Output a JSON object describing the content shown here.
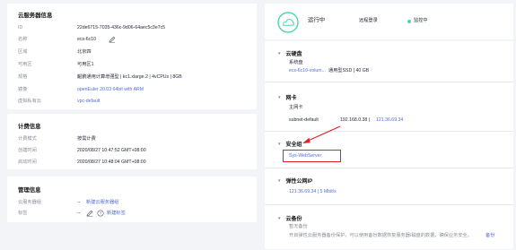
{
  "server_info": {
    "title": "云服务器信息",
    "rows": [
      {
        "label": "ID",
        "value": "22de6715-7035-436c-9d06-64aec5c3e7c5"
      },
      {
        "label": "名称",
        "value": "ecs-6c10"
      },
      {
        "label": "区域",
        "value": "北京四"
      },
      {
        "label": "可用区",
        "value": "可用区1"
      },
      {
        "label": "规格",
        "value": "鲲鹏通用计算增强型 | kc1.xlarge.2 | 4vCPUs | 8GB"
      },
      {
        "label": "镜像",
        "value": "openEuler 20.03 64bit with ARM"
      },
      {
        "label": "虚拟私有云",
        "value": "vpc-default"
      }
    ]
  },
  "billing_info": {
    "title": "计费信息",
    "rows": [
      {
        "label": "计费模式",
        "value": "按需计费"
      },
      {
        "label": "创建时间",
        "value": "2020/08/27 10:47:52 GMT+08:00"
      },
      {
        "label": "启动时间",
        "value": "2020/08/27 10:48:04 GMT+08:00"
      }
    ]
  },
  "mgmt_info": {
    "title": "管理信息",
    "rows": [
      {
        "label": "云服务器组",
        "value_prefix": "--",
        "link": "新建云服务器组"
      },
      {
        "label": "标签",
        "value_prefix": "--",
        "link": "新建标签"
      }
    ]
  },
  "status": {
    "text": "运行中",
    "action": "远程登录",
    "monitor_label": "监控中"
  },
  "sections": {
    "disk": {
      "title": "云硬盘",
      "sub_label": "系统盘",
      "disk_name": "ecs-6c10-volum...",
      "disk_detail": "通用型SSD | 40 GB"
    },
    "nic": {
      "title": "网卡",
      "sub_label": "主网卡",
      "subnet": "subnet-default",
      "ip_plain": "192.168.0.38 |",
      "ip_public": "121.36.69.34"
    },
    "security_group": {
      "title": "安全组",
      "name": "Sys-WebServer"
    },
    "eip": {
      "title": "弹性公网IP",
      "value": "121.36.69.34 | 5 Mbit/s"
    },
    "backup": {
      "title": "云备份",
      "sub_label": "暂无备份",
      "desc": "开启弹性云服务器备份保护，可以使用备份数据恢复服务器/磁盘的数据，确保业务安全。",
      "link": "备份"
    }
  },
  "colors": {
    "accent": "#526ecc",
    "success": "#50d4ab",
    "annotation": "#e0202a"
  }
}
